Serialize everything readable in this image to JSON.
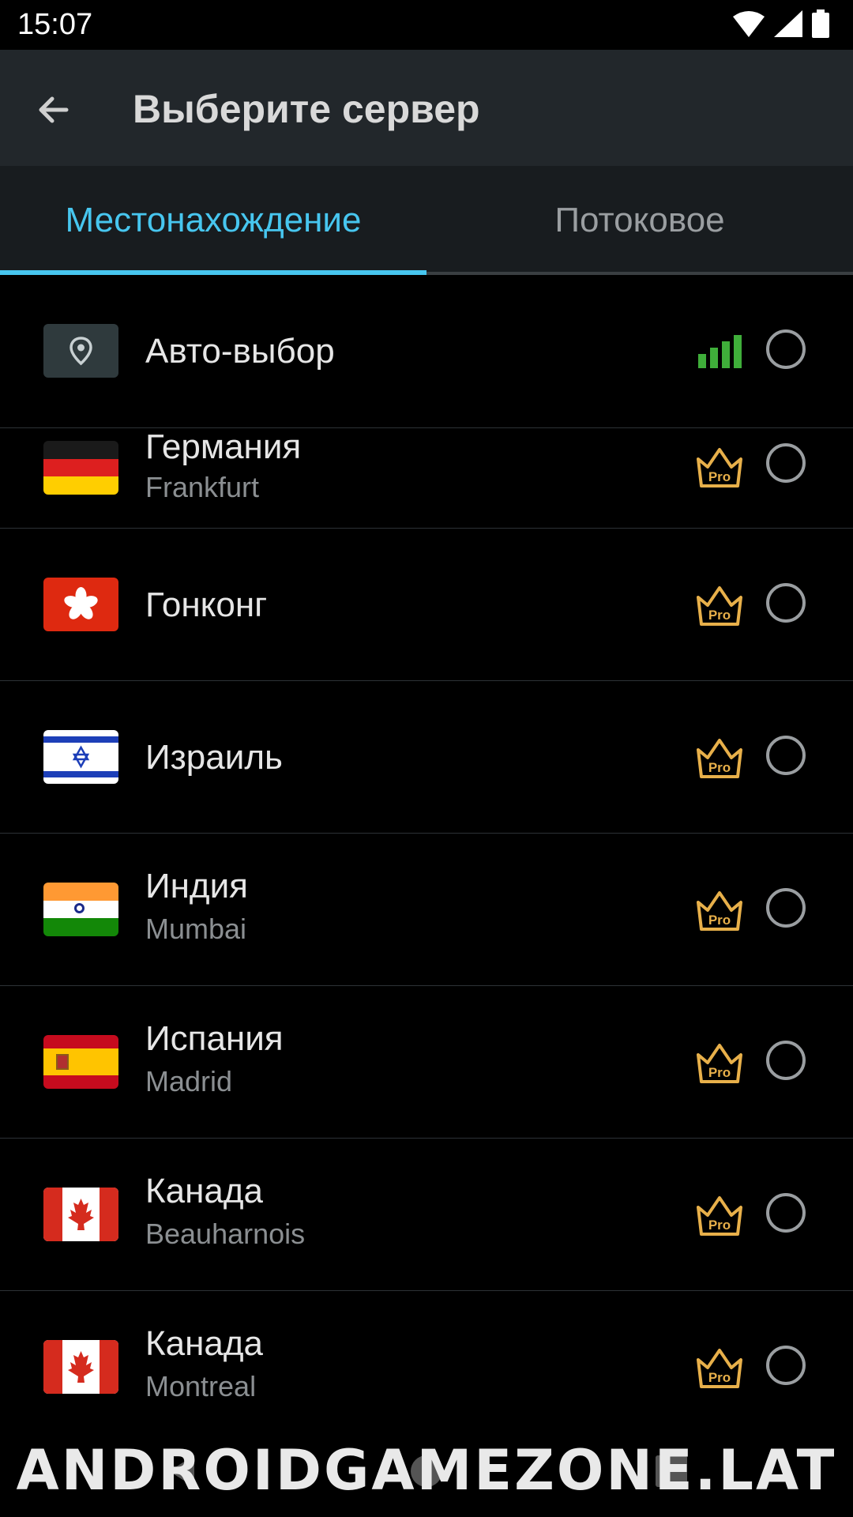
{
  "status_bar": {
    "time": "15:07"
  },
  "app_bar": {
    "title": "Выберите сервер"
  },
  "tabs": [
    {
      "label": "Местонахождение",
      "active": true
    },
    {
      "label": "Потоковое",
      "active": false
    }
  ],
  "auto_select": {
    "label": "Авто-выбор",
    "signal_color": "#3fae3a"
  },
  "servers": [
    {
      "country": "Германия",
      "city": "Frankfurt",
      "flag": "germany-flag-icon"
    },
    {
      "country": "Гонконг",
      "city": "",
      "flag": "hong-kong-flag-icon"
    },
    {
      "country": "Израиль",
      "city": "",
      "flag": "israel-flag-icon"
    },
    {
      "country": "Индия",
      "city": "Mumbai",
      "flag": "india-flag-icon"
    },
    {
      "country": "Испания",
      "city": "Madrid",
      "flag": "spain-flag-icon"
    },
    {
      "country": "Канада",
      "city": "Beauharnois",
      "flag": "canada-flag-icon"
    },
    {
      "country": "Канада",
      "city": "Montreal",
      "flag": "canada-flag-icon"
    }
  ],
  "pro_badge_label": "Pro",
  "watermark": "ANDROIDGAMEZONE.LAT",
  "colors": {
    "accent": "#47c6ef",
    "pro_gold": "#e8b04a",
    "signal_green": "#3fae3a"
  }
}
